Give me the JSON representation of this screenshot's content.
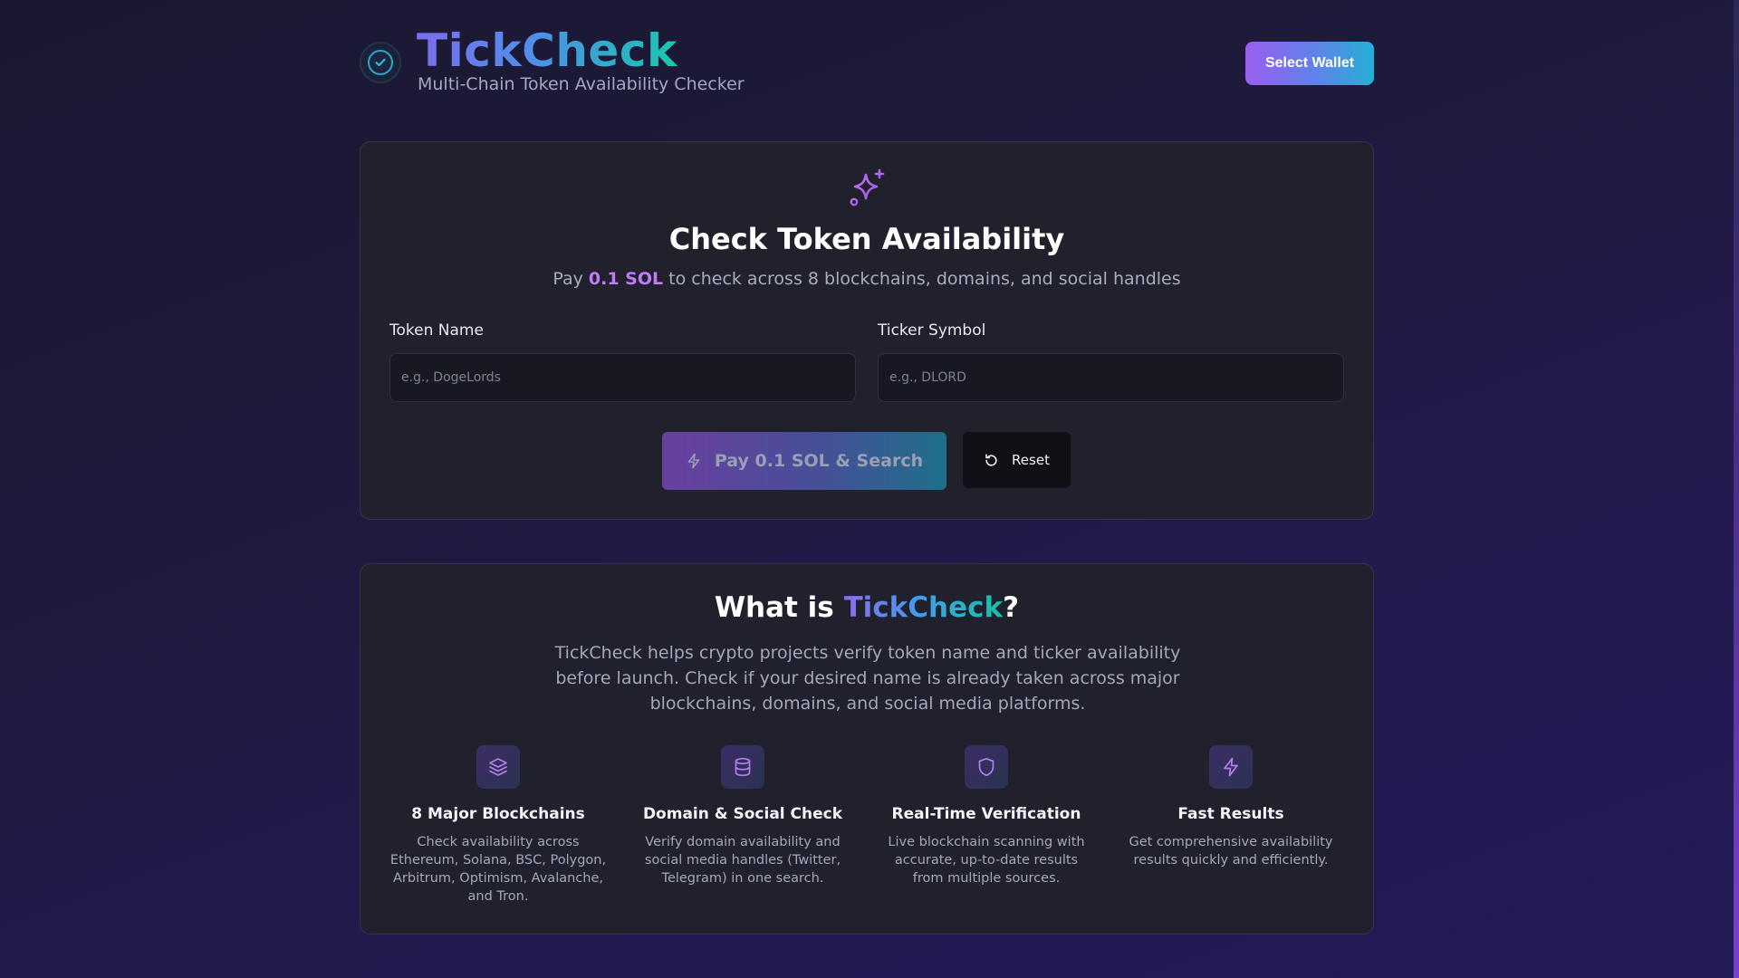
{
  "header": {
    "title": "TickCheck",
    "subtitle": "Multi-Chain Token Availability Checker",
    "wallet_button": "Select Wallet"
  },
  "check": {
    "title": "Check Token Availability",
    "sub_prefix": "Pay",
    "sub_price": "0.1 SOL",
    "sub_suffix": "to check across 8 blockchains, domains, and social handles",
    "token_name_label": "Token Name",
    "token_name_placeholder": "e.g., DogeLords",
    "ticker_label": "Ticker Symbol",
    "ticker_placeholder": "e.g., DLORD",
    "pay_button": "Pay 0.1 SOL & Search",
    "reset_button": "Reset"
  },
  "about": {
    "title_prefix": "What is",
    "title_brand": "TickCheck",
    "title_suffix": "?",
    "description": "TickCheck helps crypto projects verify token name and ticker availability before launch. Check if your desired name is already taken across major blockchains, domains, and social media platforms.",
    "features": [
      {
        "icon": "layers-icon",
        "title": "8 Major Blockchains",
        "desc": "Check availability across Ethereum, Solana, BSC, Polygon, Arbitrum, Optimism, Avalanche, and Tron."
      },
      {
        "icon": "database-icon",
        "title": "Domain & Social Check",
        "desc": "Verify domain availability and social media handles (Twitter, Telegram) in one search."
      },
      {
        "icon": "shield-icon",
        "title": "Real-Time Verification",
        "desc": "Live blockchain scanning with accurate, up-to-date results from multiple sources."
      },
      {
        "icon": "lightning-icon",
        "title": "Fast Results",
        "desc": "Get comprehensive availability results quickly and efficiently."
      }
    ]
  },
  "colors": {
    "accent_purple": "#c07cf5",
    "accent_teal": "#18c6b0",
    "card_bg": "#20212d",
    "page_bg": "#1e1a3c"
  }
}
